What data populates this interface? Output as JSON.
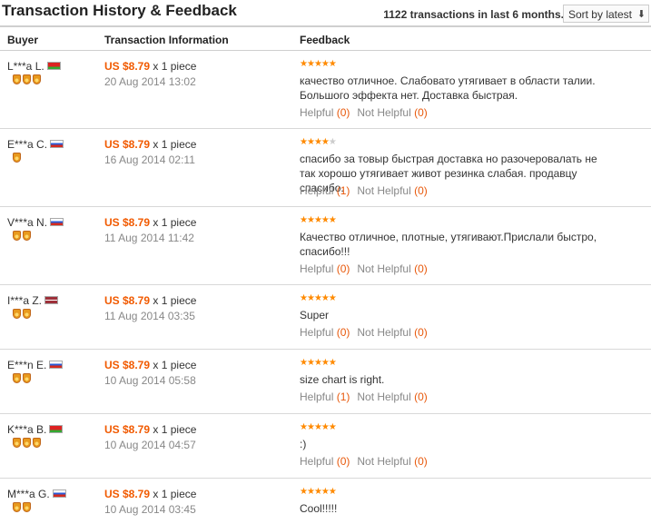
{
  "header": {
    "title": "Transaction History & Feedback",
    "summary": "1122 transactions in last 6 months.",
    "sort_label": "Sort by latest"
  },
  "columns": {
    "buyer": "Buyer",
    "info": "Transaction Information",
    "feedback": "Feedback"
  },
  "helpful_labels": {
    "helpful": "Helpful",
    "not_helpful": "Not Helpful"
  },
  "rows": [
    {
      "buyer": "L***a L.",
      "flag": "by",
      "medals": 3,
      "price": "US $8.79",
      "qty": "x 1 piece",
      "date": "20 Aug 2014 13:02",
      "stars": 5,
      "text": "качество отличное. Слабовато утягивает в области талии. Большого эффекта нет. Доставка быстрая.",
      "helpful": "(0)",
      "not_helpful": "(0)"
    },
    {
      "buyer": "E***a C.",
      "flag": "ru",
      "medals": 1,
      "price": "US $8.79",
      "qty": "x 1 piece",
      "date": "16 Aug 2014 02:11",
      "stars": 4,
      "text": "спасибо за товыр быстрая доставка но разочеровалать не так хорошо утягивает живот резинка слабая. продавцу спасибо.",
      "helpful": "(1)",
      "not_helpful": "(0)"
    },
    {
      "buyer": "V***a N.",
      "flag": "ru",
      "medals": 2,
      "price": "US $8.79",
      "qty": "x 1 piece",
      "date": "11 Aug 2014 11:42",
      "stars": 5,
      "text": "Качество отличное, плотные, утягивают.Прислали быстро, спасибо!!!",
      "helpful": "(0)",
      "not_helpful": "(0)"
    },
    {
      "buyer": "I***a Z.",
      "flag": "lv",
      "medals": 2,
      "price": "US $8.79",
      "qty": "x 1 piece",
      "date": "11 Aug 2014 03:35",
      "stars": 5,
      "text": "Super",
      "helpful": "(0)",
      "not_helpful": "(0)"
    },
    {
      "buyer": "E***n E.",
      "flag": "ru",
      "medals": 2,
      "price": "US $8.79",
      "qty": "x 1 piece",
      "date": "10 Aug 2014 05:58",
      "stars": 5,
      "text": "size chart is right.",
      "helpful": "(1)",
      "not_helpful": "(0)"
    },
    {
      "buyer": "K***a B.",
      "flag": "by",
      "medals": 3,
      "price": "US $8.79",
      "qty": "x 1 piece",
      "date": "10 Aug 2014 04:57",
      "stars": 5,
      "text": ":)",
      "helpful": "(0)",
      "not_helpful": "(0)"
    },
    {
      "buyer": "M***a G.",
      "flag": "ru",
      "medals": 2,
      "price": "US $8.79",
      "qty": "x 1 piece",
      "date": "10 Aug 2014 03:45",
      "stars": 5,
      "text": "Cool!!!!!",
      "helpful": "",
      "not_helpful": ""
    }
  ],
  "colors": {
    "price": "#f15a00",
    "star_on": "#ff8a00",
    "star_off": "#cccccc",
    "count": "#e8590c"
  }
}
